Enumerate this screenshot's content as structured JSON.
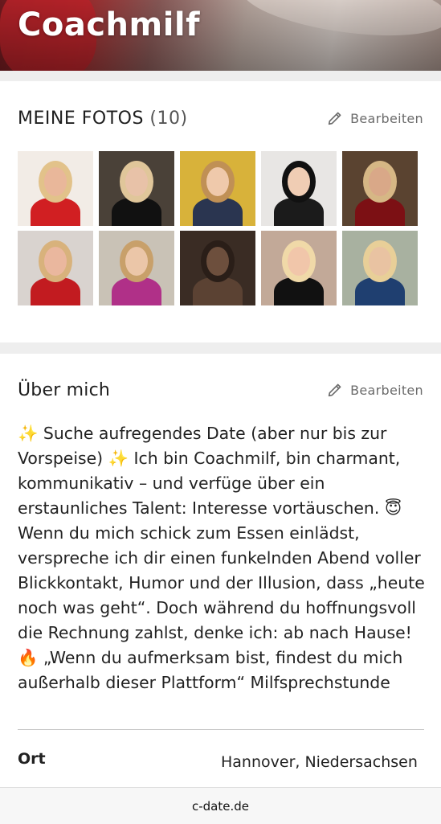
{
  "profile": {
    "name": "Coachmilf"
  },
  "photos_section": {
    "title": "MEINE FOTOS",
    "count": "(10)",
    "edit_label": "Bearbeiten",
    "edit_icon": "pencil-icon",
    "photos": [
      {
        "id": "photo-1",
        "bg": "#f2ece6",
        "accent": "#d11f22",
        "skin": "#e9b79a",
        "hair": "#e2c28a"
      },
      {
        "id": "photo-2",
        "bg": "#4a4138",
        "accent": "#111111",
        "skin": "#e8c2a8",
        "hair": "#e0c69a"
      },
      {
        "id": "photo-3",
        "bg": "#d8b23a",
        "accent": "#2a3550",
        "skin": "#efc9ab",
        "hair": "#c09055"
      },
      {
        "id": "photo-4",
        "bg": "#e8e6e4",
        "accent": "#1b1b1b",
        "skin": "#f0cdb4",
        "hair": "#111111"
      },
      {
        "id": "photo-5",
        "bg": "#5a4330",
        "accent": "#7c1014",
        "skin": "#d9a888",
        "hair": "#d6b785"
      },
      {
        "id": "photo-6",
        "bg": "#d9d3cf",
        "accent": "#c21b20",
        "skin": "#eab79e",
        "hair": "#d8b27c"
      },
      {
        "id": "photo-7",
        "bg": "#c9c2b6",
        "accent": "#b03088",
        "skin": "#ebc6a8",
        "hair": "#c8a06a"
      },
      {
        "id": "photo-8",
        "bg": "#3a2c24",
        "accent": "#5b4233",
        "skin": "#6d4f3d",
        "hair": "#2a1e18"
      },
      {
        "id": "photo-9",
        "bg": "#c2a998",
        "accent": "#111111",
        "skin": "#f1c6aa",
        "hair": "#f0d9a8"
      },
      {
        "id": "photo-10",
        "bg": "#a8b1a0",
        "accent": "#1f3f70",
        "skin": "#e9c3a2",
        "hair": "#e8cf98"
      }
    ]
  },
  "about_section": {
    "title": "Über mich",
    "edit_label": "Bearbeiten",
    "edit_icon": "pencil-icon",
    "text": "✨ Suche aufregendes Date (aber nur bis zur Vorspeise) ✨ Ich bin Coachmilf, bin charmant, kommunikativ – und verfüge über ein erstaunliches Talent: Interesse vortäuschen. 😇 Wenn du mich schick zum Essen einlädst, verspreche ich dir einen funkelnden Abend voller Blickkontakt, Humor und der Illusion, dass „heute noch was geht“. Doch während du hoffnungsvoll die Rechnung zahlst, denke ich: ab nach Hause! 🔥 „Wenn du aufmerksam bist, findest du mich außerhalb dieser Plattform“ Milfsprechstunde"
  },
  "details": {
    "location_label": "Ort",
    "location_value": "Hannover, Niedersachsen"
  },
  "browser": {
    "url": "c-date.de"
  },
  "colors": {
    "card_bg": "#ffffff",
    "page_bg": "#eeeeee",
    "muted_text": "#6b6b6b"
  }
}
